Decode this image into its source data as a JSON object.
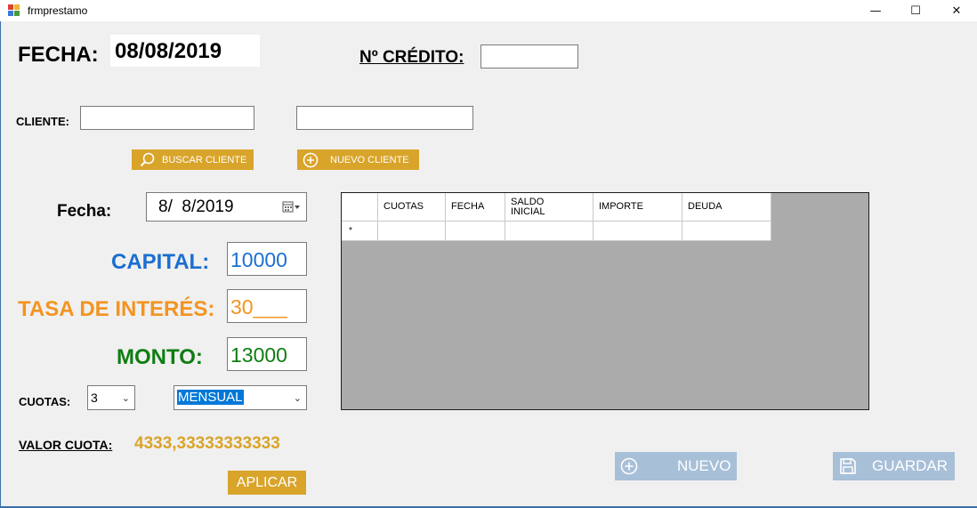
{
  "window": {
    "title": "frmprestamo",
    "minimize_glyph": "—",
    "maximize_glyph": "☐",
    "close_glyph": "✕"
  },
  "header": {
    "fecha_label": "FECHA:",
    "fecha_value": "08/08/2019",
    "credito_label": "Nº CRÉDITO:",
    "credito_value": ""
  },
  "cliente": {
    "label": "CLIENTE:",
    "id_value": "",
    "name_value": "",
    "buscar_label": "BUSCAR CLIENTE",
    "nuevo_label": "NUEVO CLIENTE"
  },
  "form": {
    "fecha_label": "Fecha:",
    "fecha_value": "8/  8/2019",
    "capital_label": "CAPITAL:",
    "capital_value": "10000",
    "tasa_label": "TASA DE INTERÉS:",
    "tasa_value": "30___",
    "monto_label": "MONTO:",
    "monto_value": "13000",
    "cuotas_label": "CUOTAS:",
    "cuotas_value": "3",
    "periodo_value": "MENSUAL",
    "valor_cuota_label": "VALOR CUOTA:",
    "valor_cuota_value": "4333,33333333333",
    "aplicar_label": "APLICAR"
  },
  "grid": {
    "columns": [
      "CUOTAS",
      "FECHA",
      "SALDO\nINICIAL",
      "IMPORTE",
      "DEUDA"
    ],
    "new_row_marker": "*"
  },
  "actions": {
    "nuevo_label": "NUEVO",
    "guardar_label": "GUARDAR"
  },
  "colors": {
    "capital": "#1a6fd0",
    "tasa": "#f39421",
    "monto": "#0f7d12",
    "accent_yellow": "#d9a42a",
    "button_blue": "#a8bfd8",
    "grid_bg": "#ababab"
  }
}
